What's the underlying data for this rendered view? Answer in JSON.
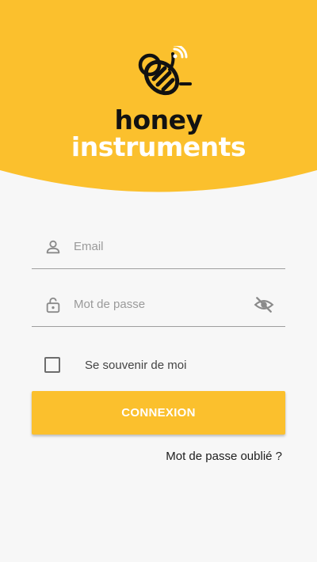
{
  "brand": {
    "line1": "honey",
    "line2": "instruments",
    "logo_icon": "bee-wifi-logo-icon"
  },
  "form": {
    "email_placeholder": "Email",
    "email_icon": "person-icon",
    "password_placeholder": "Mot de passe",
    "password_icon": "lock-icon",
    "visibility_icon": "eye-off-icon",
    "remember_label": "Se souvenir de moi",
    "remember_checked": false,
    "submit_label": "CONNEXION",
    "forgot_label": "Mot de passe oublié ?"
  },
  "colors": {
    "brand_yellow": "#fbc02d",
    "background": "#f7f7f7"
  }
}
